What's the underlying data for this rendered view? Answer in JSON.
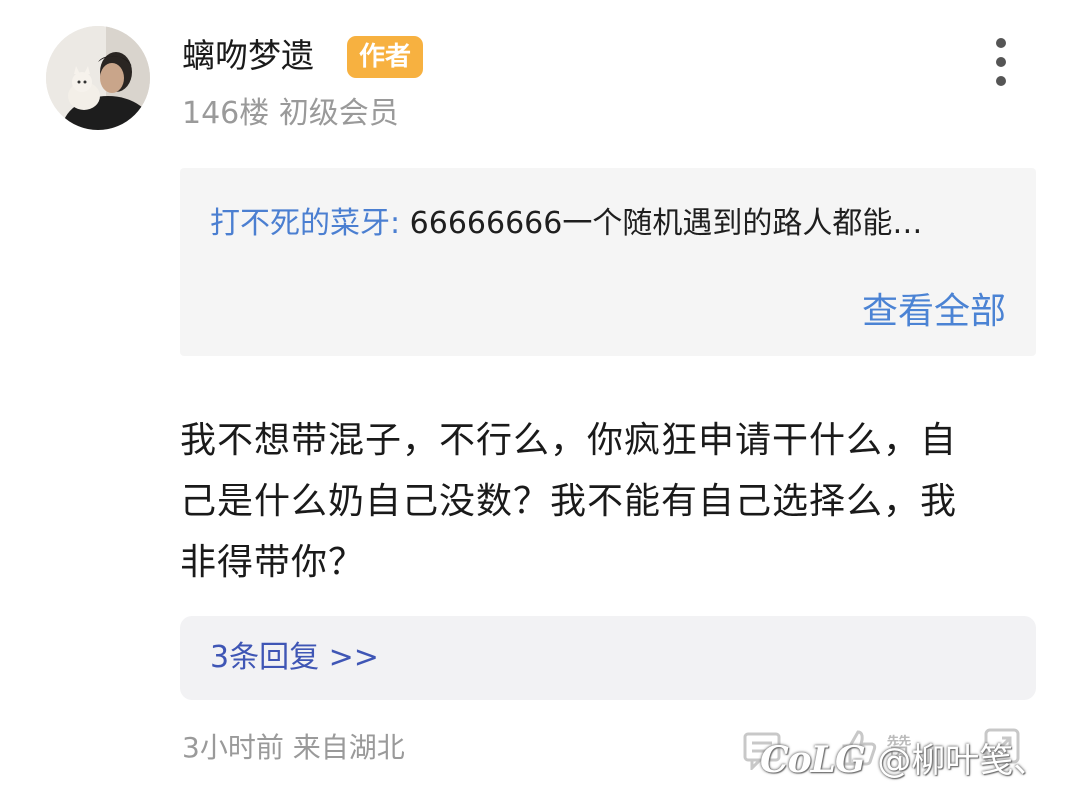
{
  "post": {
    "username": "螭吻梦遗",
    "author_badge": "作者",
    "floor": "146楼",
    "member_level": "初级会员",
    "more_icon": "more-vertical-icon",
    "avatar_icon": "user-avatar-photo"
  },
  "quote": {
    "author": "打不死的菜牙:",
    "text": "66666666一个随机遇到的路人都能…",
    "view_all": "查看全部"
  },
  "comment": {
    "lines": [
      "我不想带混子，不行么，你疯狂申请干什么，自",
      "己是什么奶自己没数？我不能有自己选择么，我",
      "非得带你？"
    ]
  },
  "replies": {
    "label": "3条回复 >>"
  },
  "footer": {
    "time": "3小时前",
    "location": "来自湖北",
    "like_label": "赞",
    "icons": [
      "reply-icon",
      "like-icon",
      "share-icon"
    ]
  },
  "watermark": {
    "brand": "CoLG",
    "handle": "@柳叶笺、"
  },
  "colors": {
    "badge": "#f7b140",
    "link_blue": "#4b83d4",
    "reply_link": "#3f56b5",
    "meta_gray": "#9a9a9a"
  }
}
